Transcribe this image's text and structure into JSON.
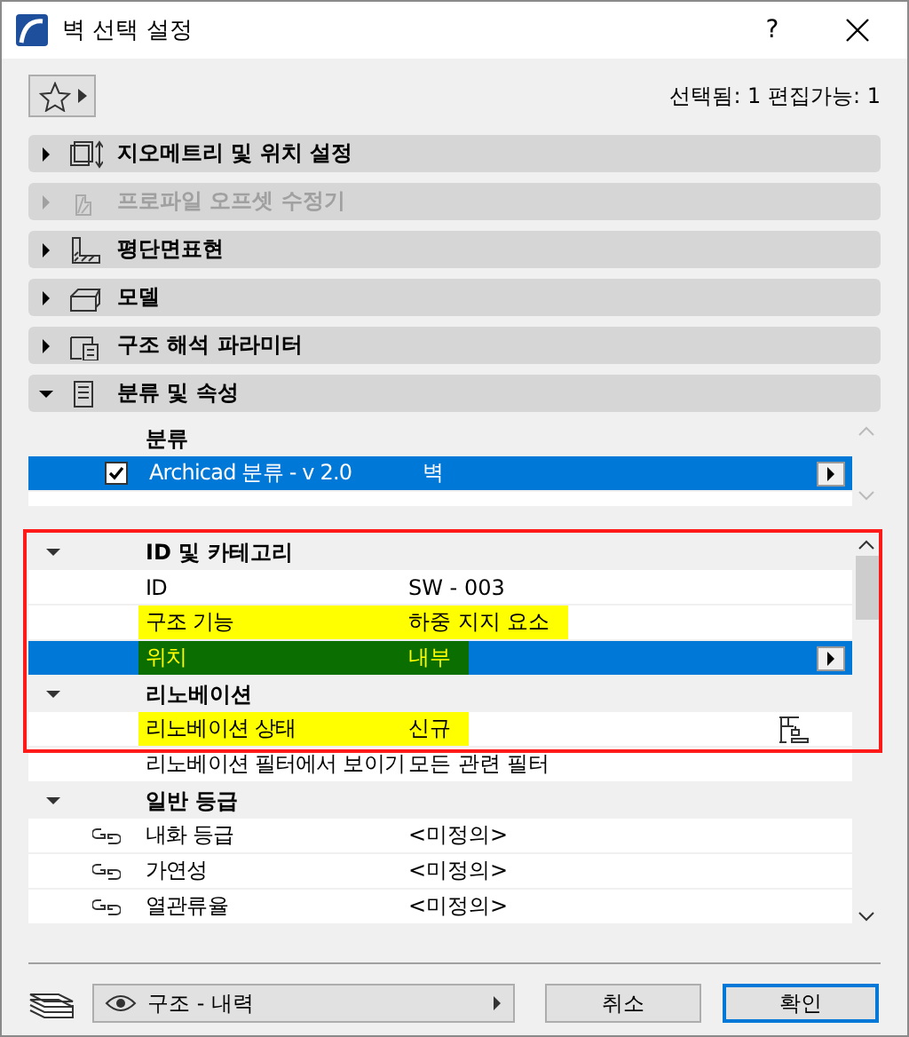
{
  "window": {
    "title": "벽 선택 설정",
    "help": "?"
  },
  "toolbar": {
    "selection_info": "선택됨: 1 편집가능: 1"
  },
  "sections": [
    {
      "label": "지오메트리 및 위치 설정",
      "expanded": false,
      "disabled": false
    },
    {
      "label": "프로파일 오프셋 수정기",
      "expanded": false,
      "disabled": true
    },
    {
      "label": "평단면표현",
      "expanded": false,
      "disabled": false
    },
    {
      "label": "모델",
      "expanded": false,
      "disabled": false
    },
    {
      "label": "구조 해석 파라미터",
      "expanded": false,
      "disabled": false
    },
    {
      "label": "분류 및 속성",
      "expanded": true,
      "disabled": false
    }
  ],
  "classifications": {
    "header": "분류",
    "rows": [
      {
        "checked": true,
        "name": "Archicad 분류 - v 2.0",
        "value": "벽",
        "selected": true
      }
    ]
  },
  "properties": {
    "framed": true,
    "groups": [
      {
        "label": "ID 및 카테고리",
        "expanded": true,
        "rows": [
          {
            "name": "ID",
            "value": "SW - 003",
            "selected": false,
            "highlighted": false,
            "linked": false,
            "status_icon": false
          },
          {
            "name": "구조 기능",
            "value": "하중 지지 요소",
            "selected": false,
            "highlighted": true,
            "linked": false,
            "status_icon": false
          },
          {
            "name": "위치",
            "value": "내부",
            "selected": true,
            "highlighted": true,
            "linked": false,
            "status_icon": false
          }
        ]
      },
      {
        "label": "리노베이션",
        "expanded": true,
        "rows": [
          {
            "name": "리노베이션 상태",
            "value": "신규",
            "selected": false,
            "highlighted": true,
            "linked": false,
            "status_icon": true
          },
          {
            "name": "리노베이션 필터에서 보이기",
            "value": "모든 관련 필터",
            "selected": false,
            "highlighted": false,
            "linked": false,
            "status_icon": false
          }
        ]
      },
      {
        "label": "일반 등급",
        "expanded": true,
        "rows": [
          {
            "name": "내화 등급",
            "value": "<미정의>",
            "selected": false,
            "highlighted": false,
            "linked": true,
            "status_icon": false
          },
          {
            "name": "가연성",
            "value": "<미정의>",
            "selected": false,
            "highlighted": false,
            "linked": true,
            "status_icon": false
          },
          {
            "name": "열관류율",
            "value": "<미정의>",
            "selected": false,
            "highlighted": false,
            "linked": true,
            "status_icon": false
          }
        ]
      }
    ]
  },
  "footer": {
    "layer": "구조 - 내력",
    "cancel": "취소",
    "ok": "확인"
  }
}
